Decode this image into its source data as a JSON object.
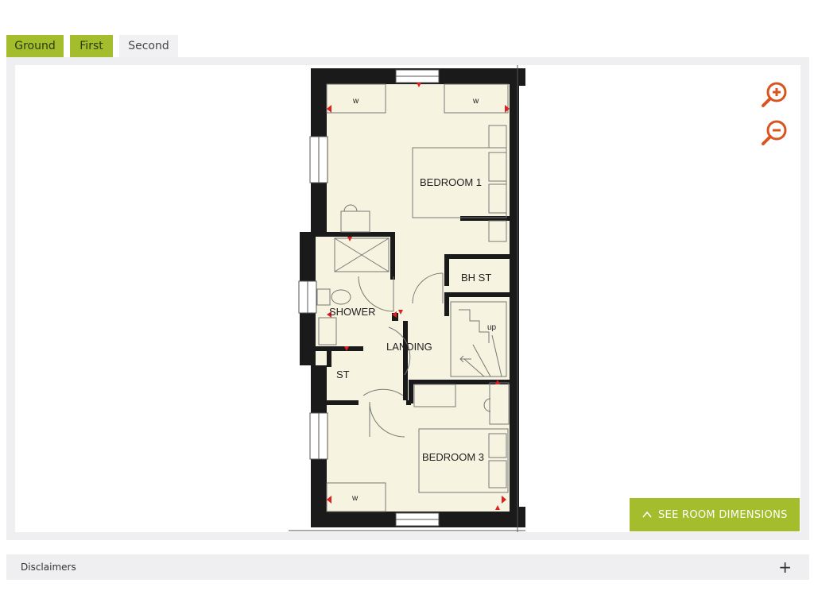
{
  "tabs": [
    {
      "label": "Ground"
    },
    {
      "label": "First"
    },
    {
      "label": "Second"
    }
  ],
  "active_tab": "Second",
  "floorplan": {
    "rooms": {
      "bedroom1": "BEDROOM 1",
      "bh_st": "BH ST",
      "shower": "SHOWER",
      "landing": "LANDING",
      "st": "ST",
      "bedroom3": "BEDROOM 3",
      "stairs_up": "up",
      "wardrobe": "w"
    }
  },
  "zoom": {
    "in_icon": "zoom-in-icon",
    "out_icon": "zoom-out-icon"
  },
  "room_dimensions_button": {
    "label": "SEE ROOM DIMENSIONS",
    "icon": "chevron-up-icon"
  },
  "disclaimers": {
    "label": "Disclaimers",
    "toggle": "+"
  },
  "colors": {
    "accent": "#a3bd2c",
    "zoom_icon": "#d9541e",
    "floor": "#f6f4e0",
    "wall": "#1a1a1a",
    "marker": "#e02020"
  }
}
